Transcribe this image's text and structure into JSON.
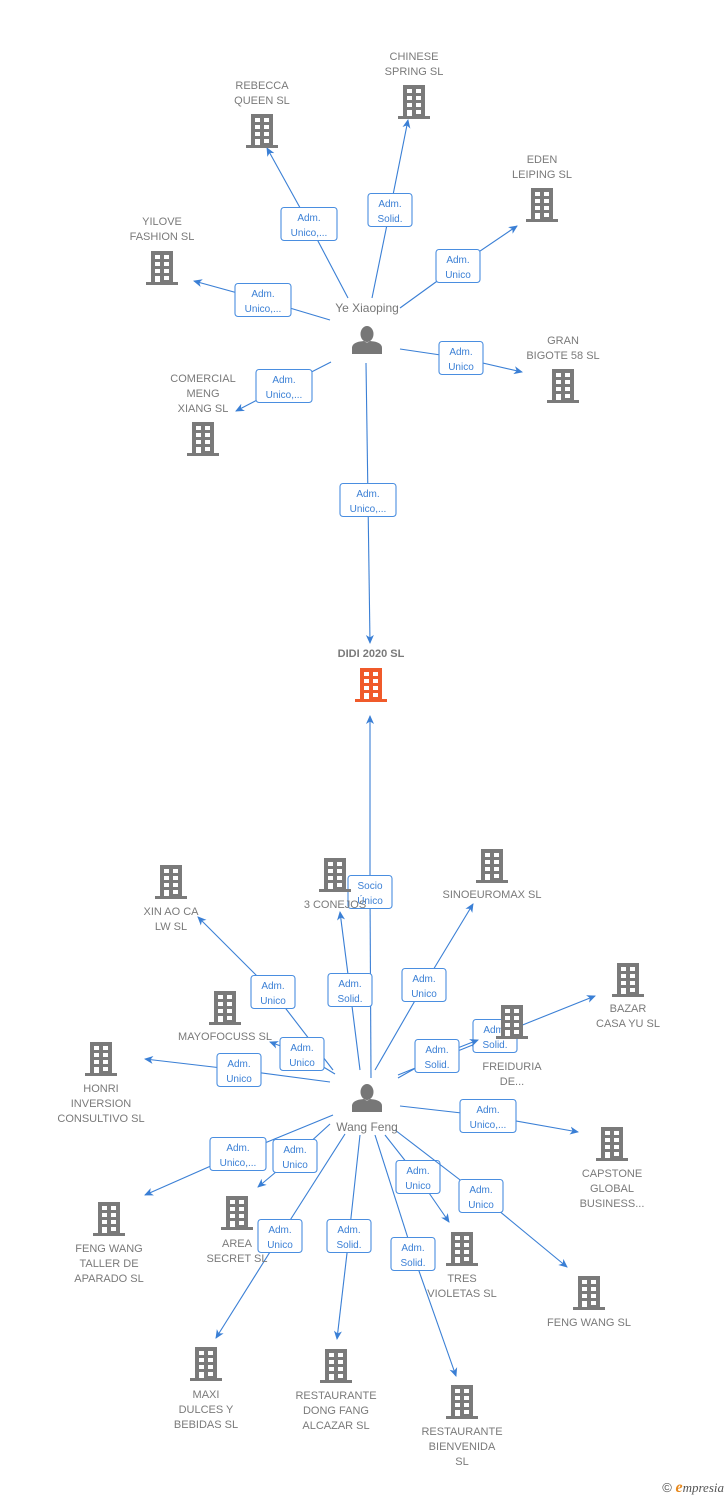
{
  "colors": {
    "edge": "#3a7fd5",
    "building": "#7a7a7a",
    "focus_building": "#f05a2a",
    "person": "#777777"
  },
  "focus": {
    "id": "didi",
    "label": [
      "DIDI 2020  SL"
    ]
  },
  "persons": [
    {
      "id": "ye",
      "name": "Ye Xiaoping"
    },
    {
      "id": "wang",
      "name": "Wang Feng"
    }
  ],
  "companies": [
    {
      "id": "rebecca",
      "label": [
        "REBECCA",
        "QUEEN  SL"
      ]
    },
    {
      "id": "chinese",
      "label": [
        "CHINESE",
        "SPRING SL"
      ]
    },
    {
      "id": "eden",
      "label": [
        "EDEN",
        "LEIPING SL"
      ]
    },
    {
      "id": "yilove",
      "label": [
        "YILOVE",
        "FASHION SL"
      ]
    },
    {
      "id": "gran",
      "label": [
        "GRAN",
        "BIGOTE 58  SL"
      ]
    },
    {
      "id": "comercial",
      "label": [
        "COMERCIAL",
        "MENG",
        "XIANG SL"
      ]
    },
    {
      "id": "xinao",
      "label": [
        "XIN AO CA",
        "LW SL"
      ]
    },
    {
      "id": "conejo",
      "label": [
        "3 CONEJOS"
      ]
    },
    {
      "id": "sinoeuromax",
      "label": [
        "SINOEUROMAX SL"
      ]
    },
    {
      "id": "bazar",
      "label": [
        "BAZAR",
        "CASA YU SL"
      ]
    },
    {
      "id": "mayofocuss",
      "label": [
        "MAYOFOCUSS SL"
      ]
    },
    {
      "id": "freiduria",
      "label": [
        "FREIDURIA",
        "DE..."
      ]
    },
    {
      "id": "honri",
      "label": [
        "HONRI",
        "INVERSION",
        "CONSULTIVO SL"
      ]
    },
    {
      "id": "capstone",
      "label": [
        "CAPSTONE",
        "GLOBAL",
        "BUSINESS..."
      ]
    },
    {
      "id": "fengtaller",
      "label": [
        "FENG WANG",
        "TALLER DE",
        "APARADO SL"
      ]
    },
    {
      "id": "area",
      "label": [
        "AREA",
        "SECRET SL"
      ]
    },
    {
      "id": "tres",
      "label": [
        "TRES",
        "VIOLETAS SL"
      ]
    },
    {
      "id": "fengwang",
      "label": [
        "FENG WANG SL"
      ]
    },
    {
      "id": "maxi",
      "label": [
        "MAXI",
        "DULCES Y",
        "BEBIDAS  SL"
      ]
    },
    {
      "id": "dongfang",
      "label": [
        "RESTAURANTE",
        "DONG FANG",
        "ALCAZAR  SL"
      ]
    },
    {
      "id": "bienvenida",
      "label": [
        "RESTAURANTE",
        "BIENVENIDA",
        "SL"
      ]
    }
  ],
  "edges": [
    {
      "from": "ye",
      "to": "rebecca",
      "role": [
        "Adm.",
        "Unico,..."
      ]
    },
    {
      "from": "ye",
      "to": "chinese",
      "role": [
        "Adm.",
        "Solid."
      ]
    },
    {
      "from": "ye",
      "to": "eden",
      "role": [
        "Adm.",
        "Unico"
      ]
    },
    {
      "from": "ye",
      "to": "yilove",
      "role": [
        "Adm.",
        "Unico,..."
      ]
    },
    {
      "from": "ye",
      "to": "gran",
      "role": [
        "Adm.",
        "Unico"
      ]
    },
    {
      "from": "ye",
      "to": "comercial",
      "role": [
        "Adm.",
        "Unico,..."
      ]
    },
    {
      "from": "ye",
      "to": "didi",
      "role": [
        "Adm.",
        "Unico,..."
      ]
    },
    {
      "from": "wang",
      "to": "didi",
      "role": [
        "Socio",
        "Único"
      ]
    },
    {
      "from": "wang",
      "to": "xinao",
      "role": [
        "Adm.",
        "Unico"
      ]
    },
    {
      "from": "wang",
      "to": "conejo",
      "role": [
        "Adm.",
        "Solid."
      ]
    },
    {
      "from": "wang",
      "to": "sinoeuromax",
      "role": [
        "Adm.",
        "Unico"
      ]
    },
    {
      "from": "wang",
      "to": "bazar",
      "role": [
        "Adm.",
        "Solid."
      ]
    },
    {
      "from": "wang",
      "to": "freiduria",
      "role": [
        "Adm.",
        "Solid."
      ]
    },
    {
      "from": "wang",
      "to": "mayofocuss",
      "role": [
        "Adm.",
        "Unico"
      ]
    },
    {
      "from": "wang",
      "to": "honri",
      "role": [
        "Adm.",
        "Unico"
      ]
    },
    {
      "from": "wang",
      "to": "capstone",
      "role": [
        "Adm.",
        "Unico,..."
      ]
    },
    {
      "from": "wang",
      "to": "fengtaller",
      "role": [
        "Adm.",
        "Unico,..."
      ]
    },
    {
      "from": "wang",
      "to": "area",
      "role": [
        "Adm.",
        "Unico"
      ]
    },
    {
      "from": "wang",
      "to": "tres",
      "role": [
        "Adm.",
        "Unico"
      ]
    },
    {
      "from": "wang",
      "to": "fengwang",
      "role": [
        "Adm.",
        "Unico"
      ]
    },
    {
      "from": "wang",
      "to": "maxi",
      "role": [
        "Adm.",
        "Unico"
      ]
    },
    {
      "from": "wang",
      "to": "dongfang",
      "role": [
        "Adm.",
        "Solid."
      ]
    },
    {
      "from": "wang",
      "to": "bienvenida",
      "role": [
        "Adm.",
        "Solid."
      ]
    }
  ],
  "footer": {
    "copyright": "©",
    "brand_initial": "e",
    "brand_rest": "mpresia"
  }
}
